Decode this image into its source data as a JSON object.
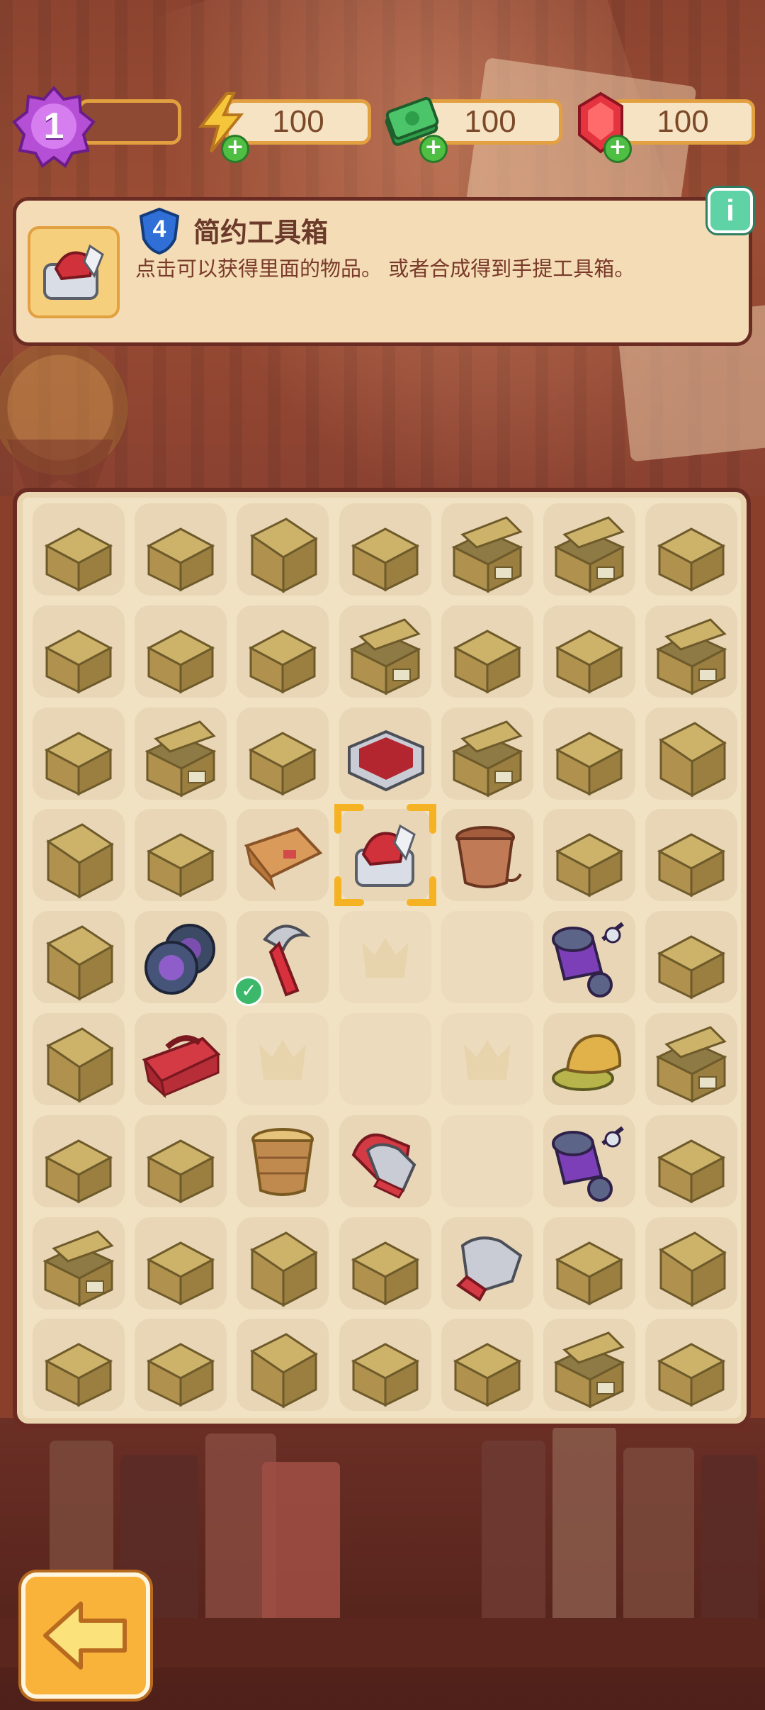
{
  "hud": {
    "level": "1",
    "energy": "100",
    "cash": "100",
    "gems": "100"
  },
  "info": {
    "item_level": "4",
    "title": "简约工具箱",
    "description": "点击可以获得里面的物品。 或者合成得到手提工具箱。"
  },
  "colors": {
    "frame": "#6a2c22",
    "accent": "#e2a040",
    "panel": "#f3dcb6",
    "board": "#f1e2c4"
  },
  "board": {
    "rows": [
      [
        "box",
        "box",
        "box-tall",
        "box",
        "box-open",
        "box-open",
        "box"
      ],
      [
        "box",
        "box",
        "box",
        "box-open",
        "box",
        "box",
        "box-open"
      ],
      [
        "box",
        "box-open",
        "box",
        "tray",
        "box-open",
        "box",
        "box-tall"
      ],
      [
        "box-tall",
        "box",
        "wallet",
        "toolbox-selected",
        "pot-brown",
        "box",
        "box"
      ],
      [
        "box-tall",
        "tires",
        "axe-check",
        "empty-crown",
        "empty",
        "scooter",
        "box"
      ],
      [
        "box-tall",
        "toolbox-red",
        "empty-crown",
        "empty",
        "empty-crown",
        "cap",
        "box-open"
      ],
      [
        "box",
        "box",
        "basket",
        "gloves",
        "empty",
        "scooter",
        "box"
      ],
      [
        "box-open",
        "box",
        "box-tall",
        "box",
        "glove",
        "box",
        "box-tall"
      ],
      [
        "box",
        "box",
        "box-tall",
        "box",
        "box",
        "box-open",
        "box"
      ]
    ]
  },
  "icons": {
    "level": "flower-badge-icon",
    "energy": "lightning-icon",
    "cash": "cash-stack-icon",
    "gems": "ruby-icon",
    "info": "info-icon",
    "back": "arrow-left-icon"
  }
}
